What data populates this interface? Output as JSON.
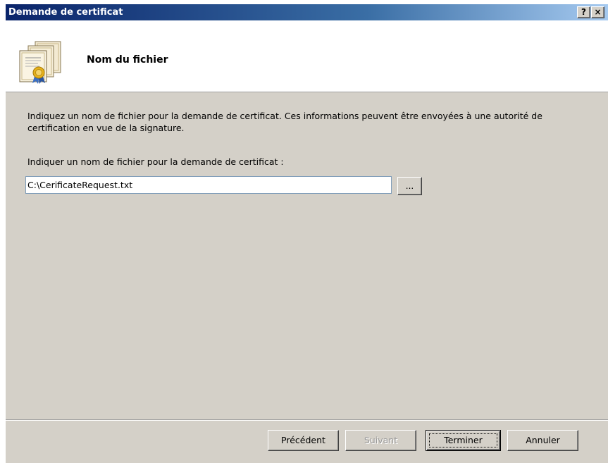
{
  "window": {
    "title": "Demande de certificat",
    "help_button": "?",
    "close_button": "×"
  },
  "header": {
    "icon": "certificate-icon",
    "title": "Nom du fichier"
  },
  "content": {
    "description": "Indiquez un nom de fichier pour la demande de certificat. Ces informations peuvent être envoyées à une autorité de certification en vue de la signature.",
    "field_label": "Indiquer un nom de fichier pour la demande de certificat :",
    "file_path_value": "C:\\CerificateRequest.txt",
    "browse_label": "..."
  },
  "footer": {
    "previous_label": "Précédent",
    "next_label": "Suivant",
    "finish_label": "Terminer",
    "cancel_label": "Annuler"
  },
  "colors": {
    "titlebar_start": "#0a246a",
    "titlebar_end": "#a6caf0",
    "dialog_background": "#d4d0c8"
  }
}
